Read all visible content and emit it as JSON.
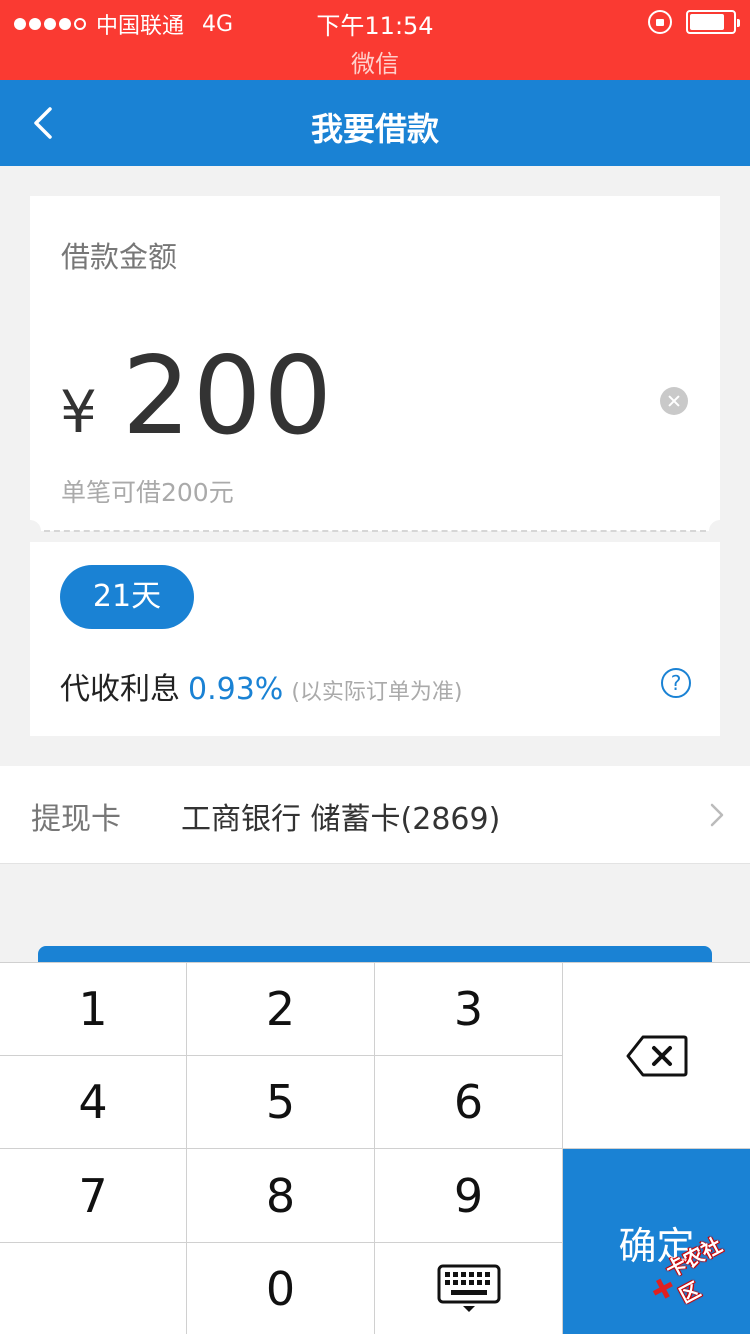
{
  "status_bar": {
    "carrier": "中国联通",
    "network": "4G",
    "time": "下午11:54",
    "app_source": "微信",
    "battery_level": 0.8
  },
  "nav": {
    "title": "我要借款",
    "back_icon": "chevron-left-icon"
  },
  "loan": {
    "amount_label": "借款金额",
    "currency_symbol": "¥",
    "amount": "200",
    "limit_text": "单笔可借200元",
    "term_label": "21天",
    "interest_label": "代收利息",
    "interest_rate": "0.93%",
    "interest_note": "(以实际订单为准)"
  },
  "withdraw_card": {
    "label": "提现卡",
    "value": "工商银行 储蓄卡(2869)"
  },
  "keypad": {
    "keys": [
      "1",
      "2",
      "3",
      "4",
      "5",
      "6",
      "7",
      "8",
      "9",
      "0"
    ],
    "confirm_label": "确定",
    "delete_icon": "backspace-icon",
    "hide_icon": "keyboard-icon"
  },
  "watermark": {
    "text": "卡农社区"
  },
  "colors": {
    "status_bar": "#fa3a32",
    "primary": "#1a82d4",
    "background": "#f2f2f2"
  }
}
